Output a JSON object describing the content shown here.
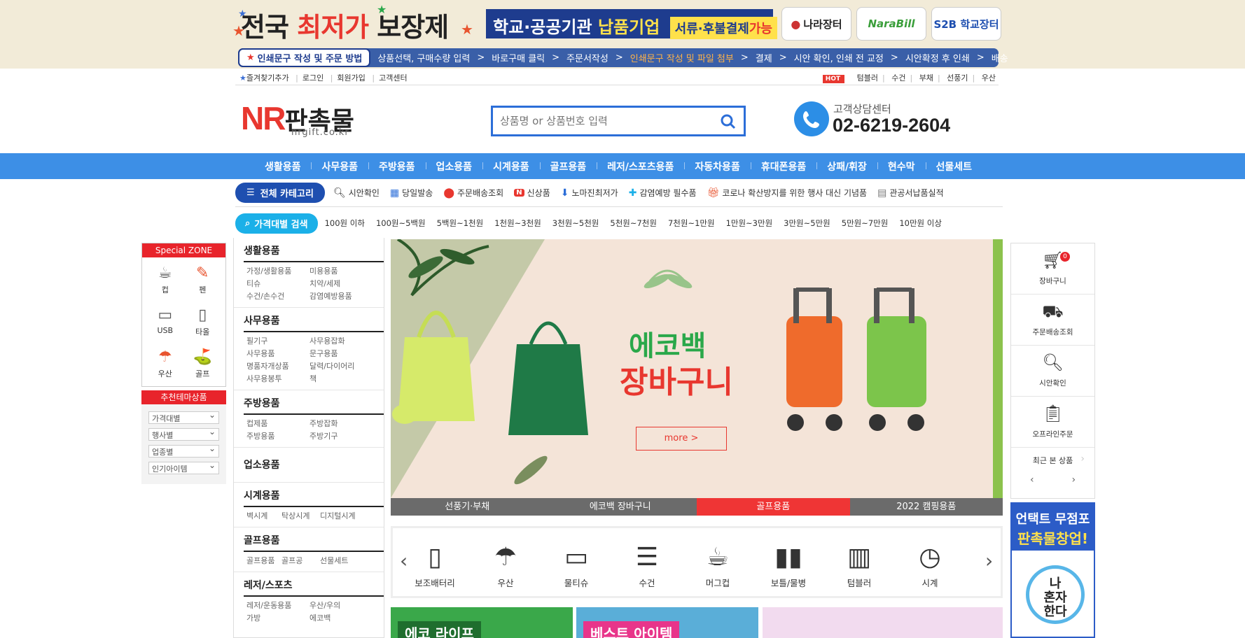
{
  "promo": {
    "text_a": "전국 ",
    "text_b": "최저가",
    "text_c": " 보장제"
  },
  "bluebox": {
    "text_a": "학교·공공기관 ",
    "text_b": "납품기업",
    "sub_a": "서류·후불결제",
    "sub_b": "가능"
  },
  "partners": [
    "나라장터",
    "NaraBill",
    "S2B 학교장터"
  ],
  "steps": {
    "first": "인쇄문구 작성 및 주문 방법",
    "items": [
      "상품선택, 구매수량 입력",
      "바로구매 클릭",
      "주문서작성",
      "인쇄문구 작성 및 파일 첨부",
      "결제",
      "시안 확인, 인쇄 전 교정",
      "시안확정 후 인쇄",
      "배송"
    ],
    "highlight_index": 3
  },
  "util": {
    "left": [
      "즐겨찾기추가",
      "로그인",
      "회원가입",
      "고객센터"
    ],
    "hot": "HOT",
    "right": [
      "텀블러",
      "수건",
      "부채",
      "선풍기",
      "우산"
    ]
  },
  "logo": {
    "nr": "NR",
    "kr": "판촉물",
    "domain": "nrgift.co.kr"
  },
  "search": {
    "placeholder": "상품명 or 상품번호 입력"
  },
  "cs": {
    "label": "고객상담센터",
    "number": "02-6219-2604"
  },
  "mainnav": [
    "생활용품",
    "사무용품",
    "주방용품",
    "업소용품",
    "시계용품",
    "골프용품",
    "레저/스포츠용품",
    "자동차용품",
    "휴대폰용품",
    "상패/휘장",
    "현수막",
    "선물세트"
  ],
  "subbar": {
    "allcat": "전체 카테고리",
    "items": [
      "시안확인",
      "당일발송",
      "주문배송조회",
      "신상품",
      "노마진최저가",
      "감염예방 필수품",
      "코로나 확산방지를 위한 행사 대신 기념품",
      "관공서납품실적"
    ]
  },
  "pricebar": {
    "label": "가격대별 검색",
    "ranges": [
      "100원 이하",
      "100원~5백원",
      "5백원~1천원",
      "1천원~3천원",
      "3천원~5천원",
      "5천원~7천원",
      "7천원~1만원",
      "1만원~3만원",
      "3만원~5만원",
      "5만원~7만원",
      "10만원 이상"
    ]
  },
  "special": {
    "title": "Special ZONE",
    "items": [
      "컵",
      "펜",
      "USB",
      "타올",
      "우산",
      "골프"
    ]
  },
  "reco": {
    "title": "추천테마상품",
    "selects": [
      "가격대별",
      "행사별",
      "업종별",
      "인기아이템"
    ]
  },
  "leftcat": [
    {
      "title": "생활용품",
      "items": [
        "가정/생활용품",
        "미용용품",
        "티슈",
        "치약/세제",
        "수건/손수건",
        "감염예방용품"
      ]
    },
    {
      "title": "사무용품",
      "items": [
        "필기구",
        "사무용잡화",
        "사무용품",
        "문구용품",
        "명품자개상품",
        "달력/다이어리",
        "사무용봉투",
        "책"
      ]
    },
    {
      "title": "주방용품",
      "items": [
        "컵제품",
        "주방잡화",
        "주방용품",
        "주방기구"
      ]
    },
    {
      "title": "업소용품",
      "items": []
    },
    {
      "title": "시계용품",
      "items": [
        "벽시계",
        "탁상시계",
        "디지털시계"
      ]
    },
    {
      "title": "골프용품",
      "items": [
        "골프용품",
        "골프공",
        "선물세트"
      ]
    },
    {
      "title": "레저/스포츠",
      "items": [
        "레저/운동용품",
        "우산/우의",
        "가방",
        "에코백"
      ]
    }
  ],
  "slider": {
    "title1": "에코백",
    "title2": "장바구니",
    "more": "more >",
    "tabs": [
      "선풍기·부채",
      "에코백 장바구니",
      "골프용품",
      "2022 캠핑용품"
    ],
    "active_tab": 2
  },
  "iconrow": [
    {
      "label": "보조배터리",
      "icon": "battery-icon",
      "glyph": "▯"
    },
    {
      "label": "우산",
      "icon": "umbrella-icon",
      "glyph": "☂"
    },
    {
      "label": "물티슈",
      "icon": "wet-tissue-icon",
      "glyph": "▭"
    },
    {
      "label": "수건",
      "icon": "towel-icon",
      "glyph": "☰"
    },
    {
      "label": "머그컵",
      "icon": "mug-icon",
      "glyph": "☕"
    },
    {
      "label": "보틀/물병",
      "icon": "bottle-icon",
      "glyph": "▮▮"
    },
    {
      "label": "텀블러",
      "icon": "tumbler-icon",
      "glyph": "▥"
    },
    {
      "label": "시계",
      "icon": "clock-icon",
      "glyph": "◷"
    }
  ],
  "promos": [
    "에코 라이프",
    "베스트 아이템",
    ""
  ],
  "rightpanel": {
    "items": [
      "장바구니",
      "주문배송조회",
      "시안확인",
      "오프라인주문"
    ],
    "cart_count": "0",
    "recent": "최근 본 상품"
  },
  "untact": {
    "line1": "언택트 무점포",
    "line2": "판촉물창업!",
    "circ1": "나",
    "circ2": "혼자",
    "circ3": "한다"
  }
}
